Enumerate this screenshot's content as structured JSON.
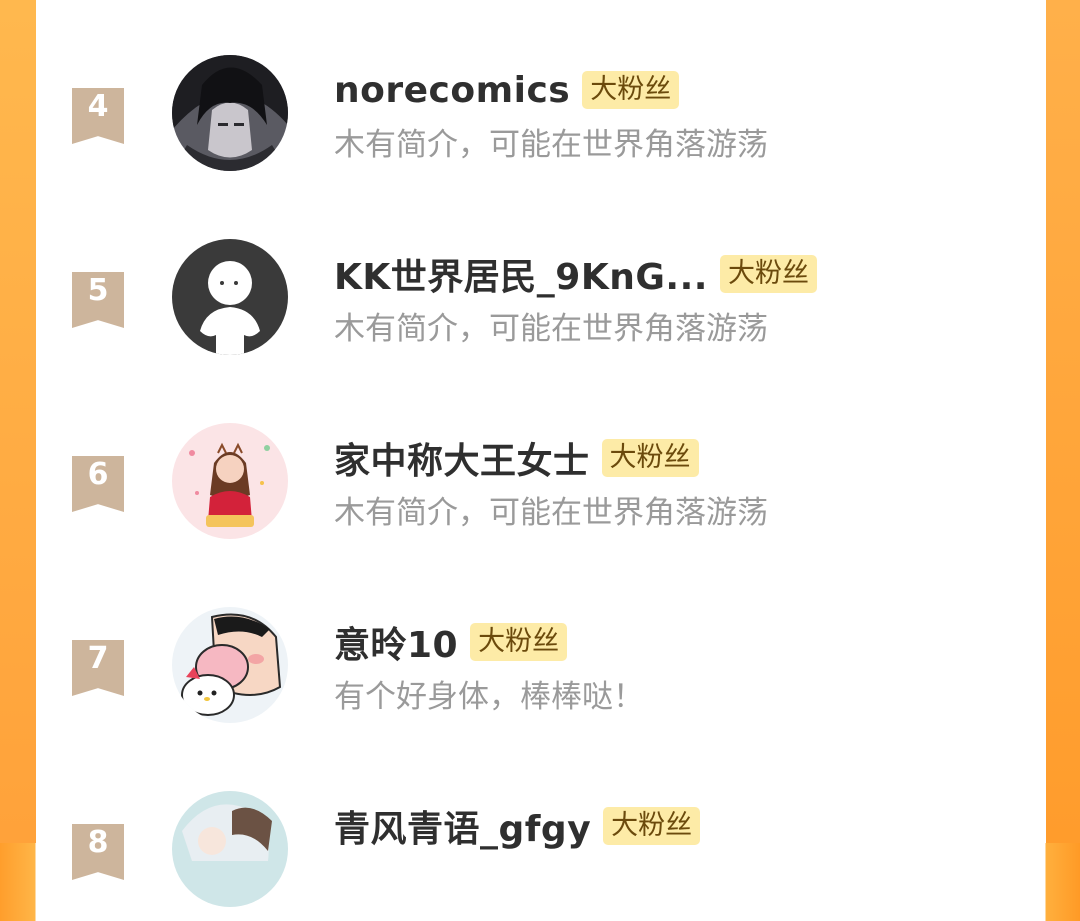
{
  "badge_label": "大粉丝",
  "fans": [
    {
      "rank": "4",
      "name": "norecomics",
      "bio": "木有简介，可能在世界角落游荡",
      "avatar": "anime-boy-avatar"
    },
    {
      "rank": "5",
      "name": "KK世界居民_9KnG...",
      "bio": "木有简介，可能在世界角落游荡",
      "avatar": "default-user-avatar"
    },
    {
      "rank": "6",
      "name": "家中称大王女士",
      "bio": "木有简介，可能在世界角落游荡",
      "avatar": "cartoon-girl-avatar"
    },
    {
      "rank": "7",
      "name": "意昤10",
      "bio": "有个好身体，棒棒哒！",
      "avatar": "crayon-shin-chan-avatar"
    },
    {
      "rank": "8",
      "name": "青风青语_gfgy",
      "bio": "",
      "avatar": "anime-pastel-avatar"
    }
  ],
  "colors": {
    "rank_ribbon": "#cdb59c",
    "badge_bg": "#fdeba7",
    "side_gradient": "#ffa23a"
  }
}
